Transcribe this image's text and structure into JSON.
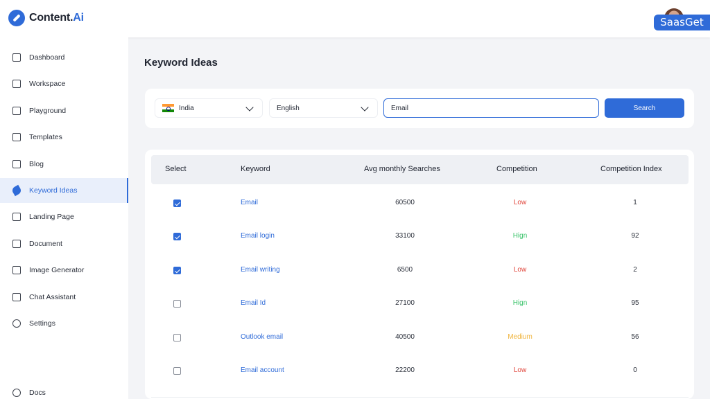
{
  "app": {
    "logo_main": "Content.",
    "logo_accent": "Ai",
    "watermark": "SaasGet"
  },
  "sidebar": {
    "items": [
      {
        "label": "Dashboard",
        "icon": "dashboard-icon"
      },
      {
        "label": "Workspace",
        "icon": "folder-icon"
      },
      {
        "label": "Playground",
        "icon": "pen-icon"
      },
      {
        "label": "Templates",
        "icon": "templates-icon"
      },
      {
        "label": "Blog",
        "icon": "blog-icon"
      },
      {
        "label": "Keyword Ideas",
        "icon": "keyword-icon",
        "active": true
      },
      {
        "label": "Landing Page",
        "icon": "landing-page-icon"
      },
      {
        "label": "Document",
        "icon": "document-icon"
      },
      {
        "label": "Image Generator",
        "icon": "image-icon"
      },
      {
        "label": "Chat Assistant",
        "icon": "chat-icon"
      },
      {
        "label": "Settings",
        "icon": "gear-icon"
      }
    ],
    "docs_label": "Docs"
  },
  "page": {
    "title": "Keyword Ideas"
  },
  "search": {
    "country": "India",
    "language": "English",
    "query": "Email",
    "button": "Search"
  },
  "table": {
    "headers": [
      "Select",
      "Keyword",
      "Avg monthly Searches",
      "Competition",
      "Competition Index"
    ],
    "rows": [
      {
        "checked": true,
        "keyword": "Email",
        "searches": "60500",
        "competition": "Low",
        "index": "1"
      },
      {
        "checked": true,
        "keyword": "Email login",
        "searches": "33100",
        "competition": "Hign",
        "index": "92"
      },
      {
        "checked": true,
        "keyword": "Email writing",
        "searches": "6500",
        "competition": "Low",
        "index": "2"
      },
      {
        "checked": false,
        "keyword": "Email Id",
        "searches": "27100",
        "competition": "Hign",
        "index": "95"
      },
      {
        "checked": false,
        "keyword": "Outlook email",
        "searches": "40500",
        "competition": "Medium",
        "index": "56"
      },
      {
        "checked": false,
        "keyword": "Email account",
        "searches": "22200",
        "competition": "Low",
        "index": "0"
      }
    ]
  },
  "colors": {
    "accent": "#2f6bd8",
    "low": "#e0443a",
    "high": "#3cc46c",
    "medium": "#f0b43c"
  }
}
